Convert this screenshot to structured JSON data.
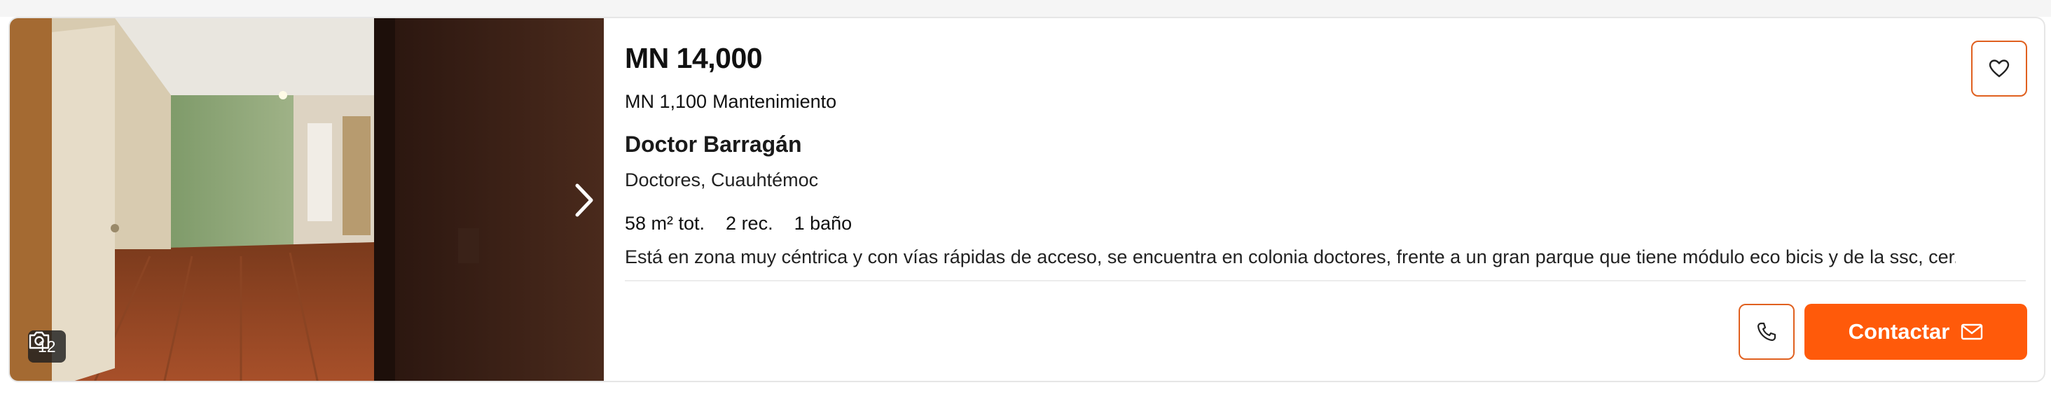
{
  "listing": {
    "price": "MN 14,000",
    "maintenance_amount": "MN 1,100",
    "maintenance_label": "Mantenimiento",
    "title": "Doctor Barragán",
    "location": "Doctores, Cuauhtémoc",
    "features": {
      "area": "58 m² tot.",
      "rooms": "2 rec.",
      "bathrooms": "1 baño"
    },
    "description": "Está en zona muy céntrica y con vías rápidas de acceso, se encuentra en colonia doctores, frente a un gran parque que tiene módulo eco bicis y de la ssc, cer..."
  },
  "gallery": {
    "photo_count": "12",
    "count_icon": "camera-icon",
    "next_icon": "chevron-right-icon"
  },
  "actions": {
    "favorite_icon": "heart-icon",
    "phone_icon": "phone-icon",
    "contact_label": "Contactar",
    "contact_icon": "mail-icon"
  },
  "colors": {
    "accent": "#ff5a0a",
    "accent_border": "#e0601f"
  }
}
